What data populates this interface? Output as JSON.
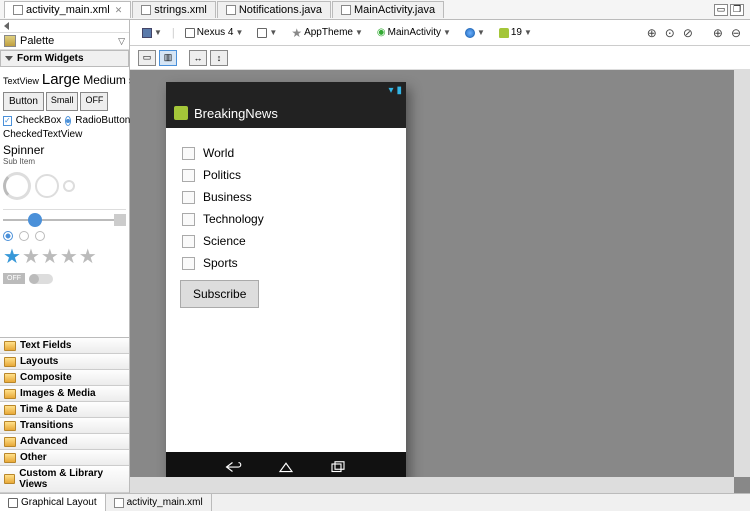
{
  "tabs": [
    {
      "label": "activity_main.xml",
      "active": true,
      "close": true
    },
    {
      "label": "strings.xml",
      "active": false
    },
    {
      "label": "Notifications.java",
      "active": false
    },
    {
      "label": "MainActivity.java",
      "active": false
    }
  ],
  "sidebar": {
    "back_label": "",
    "palette_label": "Palette",
    "section": "Form Widgets",
    "textview": "TextView",
    "large": "Large",
    "medium": "Medium",
    "small": "Small",
    "button": "Button",
    "btn_small": "Small",
    "btn_off": "OFF",
    "checkbox": "CheckBox",
    "radiobutton": "RadioButton",
    "checkedtext": "CheckedTextView",
    "spinner": "Spinner",
    "subitem": "Sub Item",
    "toggle_off": "OFF",
    "folders": [
      "Text Fields",
      "Layouts",
      "Composite",
      "Images & Media",
      "Time & Date",
      "Transitions",
      "Advanced",
      "Other",
      "Custom & Library Views"
    ]
  },
  "toolbar": {
    "device": "Nexus 4",
    "theme": "AppTheme",
    "activity": "MainActivity",
    "api": "19"
  },
  "device_preview": {
    "app_title": "BreakingNews",
    "items": [
      "World",
      "Politics",
      "Business",
      "Technology",
      "Science",
      "Sports"
    ],
    "subscribe": "Subscribe"
  },
  "bottom": {
    "graphical": "Graphical Layout",
    "xml": "activity_main.xml"
  }
}
